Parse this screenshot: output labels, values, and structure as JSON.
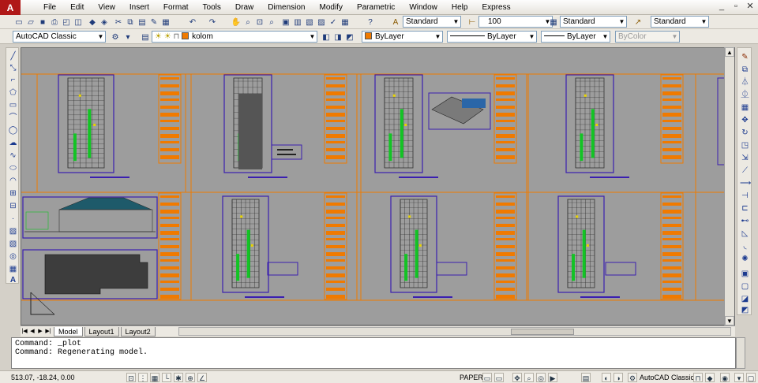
{
  "app": {
    "logo_glyph": "A"
  },
  "menus": [
    "File",
    "Edit",
    "View",
    "Insert",
    "Format",
    "Tools",
    "Draw",
    "Dimension",
    "Modify",
    "Parametric",
    "Window",
    "Help",
    "Express"
  ],
  "window_controls": [
    "_",
    "▫",
    "✕"
  ],
  "styles_toolbar": {
    "text_style": "Standard",
    "dim_style": "100",
    "table_style": "Standard",
    "multileader_style": "Standard"
  },
  "workspace_combo": "AutoCAD Classic",
  "layer_combo": "kolom",
  "properties": {
    "color": "ByLayer",
    "color_hex": "#f07a00",
    "linetype": "ByLayer",
    "lineweight": "ByLayer",
    "plot_style": "ByColor"
  },
  "tabs": [
    {
      "label": "Model",
      "active": true
    },
    {
      "label": "Layout1",
      "active": false
    },
    {
      "label": "Layout2",
      "active": false
    }
  ],
  "command_history": [
    "Command: _plot",
    "Command: Regenerating model."
  ],
  "status": {
    "coordinates": "513.07, -18.24, 0.00",
    "paper_label": "PAPER",
    "workspace": "AutoCAD Classic"
  },
  "colors": {
    "sheet_border": "#f07a00",
    "title_block_fill": "#f07a00",
    "viewport_frame": "#3a1fb0",
    "background": "#9d9d9d"
  }
}
